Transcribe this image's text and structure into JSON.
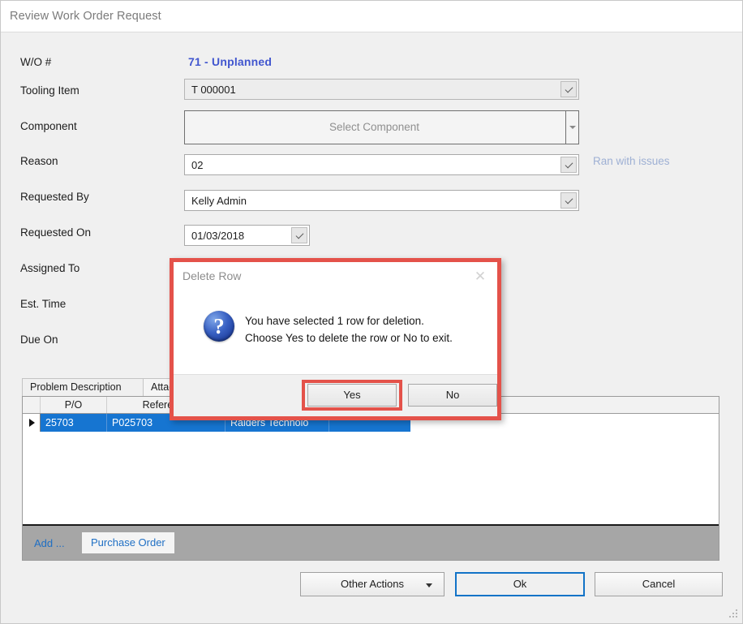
{
  "window": {
    "title": "Review Work Order Request"
  },
  "form": {
    "labels": {
      "wo": "W/O #",
      "tooling_item": "Tooling Item",
      "component": "Component",
      "reason": "Reason",
      "requested_by": "Requested By",
      "requested_on": "Requested On",
      "assigned_to": "Assigned To",
      "est_time": "Est. Time",
      "due_on": "Due On"
    },
    "wo_value": "71 - Unplanned",
    "wo_value_color": "#4156cf",
    "tooling_item_value": "T 000001",
    "component_placeholder": "Select Component",
    "reason_value": "02",
    "reason_note": "Ran with issues",
    "reason_note_color": "#9eb0d4",
    "requested_by_value": "Kelly Admin",
    "requested_on_value": "01/03/2018"
  },
  "tabs": [
    {
      "label": "Problem Description",
      "active": false
    },
    {
      "label": "Attac",
      "active": true
    }
  ],
  "grid": {
    "columns": [
      "P/O",
      "Reference",
      "",
      ""
    ],
    "rows": [
      {
        "po": "25703",
        "reference": "P025703",
        "vendor": "Raiders Technolo",
        "extra": ""
      }
    ],
    "selection_color": "#1675d1",
    "footer": {
      "add_label": "Add ...",
      "purchase_order_label": "Purchase Order"
    }
  },
  "footer_buttons": {
    "other_actions": "Other Actions",
    "ok": "Ok",
    "cancel": "Cancel"
  },
  "dialog": {
    "title": "Delete Row",
    "close_glyph": "✕",
    "icon": "question-icon",
    "message_line1": "You have selected 1 row for deletion.",
    "message_line2": "Choose Yes to delete the row or No to exit.",
    "yes_label": "Yes",
    "no_label": "No",
    "highlight_color": "#e4524a"
  }
}
